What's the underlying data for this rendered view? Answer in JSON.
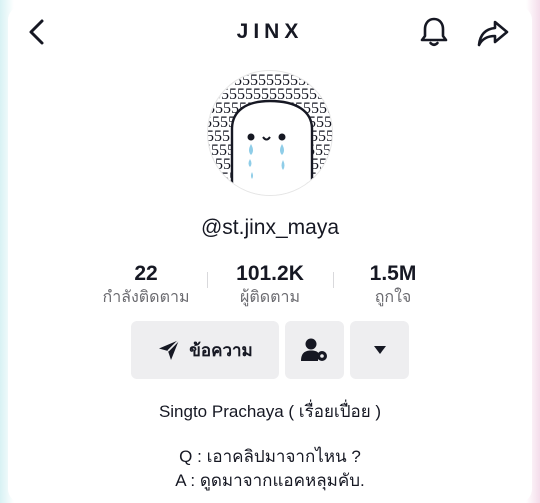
{
  "header": {
    "title": "JINX",
    "back_icon": "chevron-left-icon",
    "notify_icon": "bell-icon",
    "share_icon": "share-arrow-icon"
  },
  "profile": {
    "username": "@st.jinx_maya",
    "avatar_text": "555555555555555555555555555555555555"
  },
  "stats": [
    {
      "value": "22",
      "label": "กำลังติดตาม"
    },
    {
      "value": "101.2K",
      "label": "ผู้ติดตาม"
    },
    {
      "value": "1.5M",
      "label": "ถูกใจ"
    }
  ],
  "actions": {
    "message_label": "ข้อความ",
    "message_icon": "send-icon",
    "friend_icon": "user-settings-icon",
    "more_icon": "caret-down-icon"
  },
  "bio": {
    "name": "Singto Prachaya ( เรื่อยเปื่อย )",
    "line1": "Q : เอาคลิปมาจากไหน ?",
    "line2": "A : ดูดมาจากแอคหลุมคับ."
  },
  "colors": {
    "text": "#161823",
    "secondary_text": "#6b6b70",
    "button_bg": "#eeeef0",
    "tear": "#8fcde8"
  }
}
